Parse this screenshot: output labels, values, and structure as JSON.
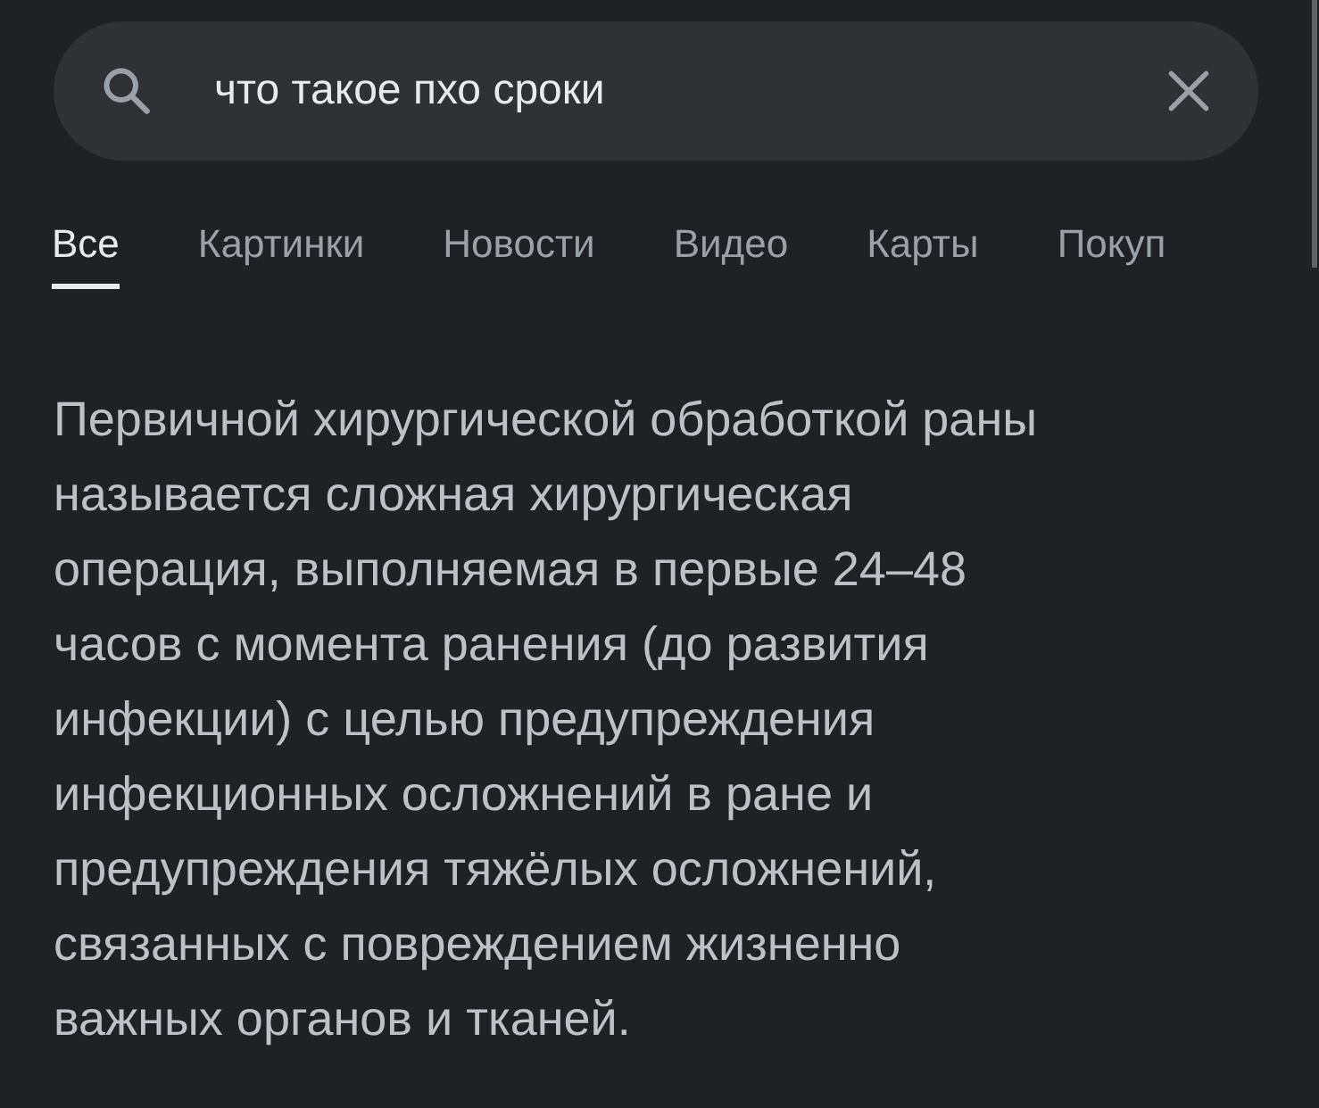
{
  "search": {
    "value": "что такое пхо сроки"
  },
  "tabs": [
    {
      "label": "Все",
      "selected": true
    },
    {
      "label": "Картинки",
      "selected": false
    },
    {
      "label": "Новости",
      "selected": false
    },
    {
      "label": "Видео",
      "selected": false
    },
    {
      "label": "Карты",
      "selected": false
    },
    {
      "label": "Покуп",
      "selected": false
    }
  ],
  "answer": "Первичной хирургической обработкой раны\nназывается сложная хирургическая\nоперация, выполняемая в первые 24–48\nчасов с момента ранения (до развития\nинфекции) с целью предупреждения\nинфекционных осложнений в ране и\nпредупреждения тяжёлых осложнений,\nсвязанных с повреждением жизненно\nважных органов и тканей."
}
